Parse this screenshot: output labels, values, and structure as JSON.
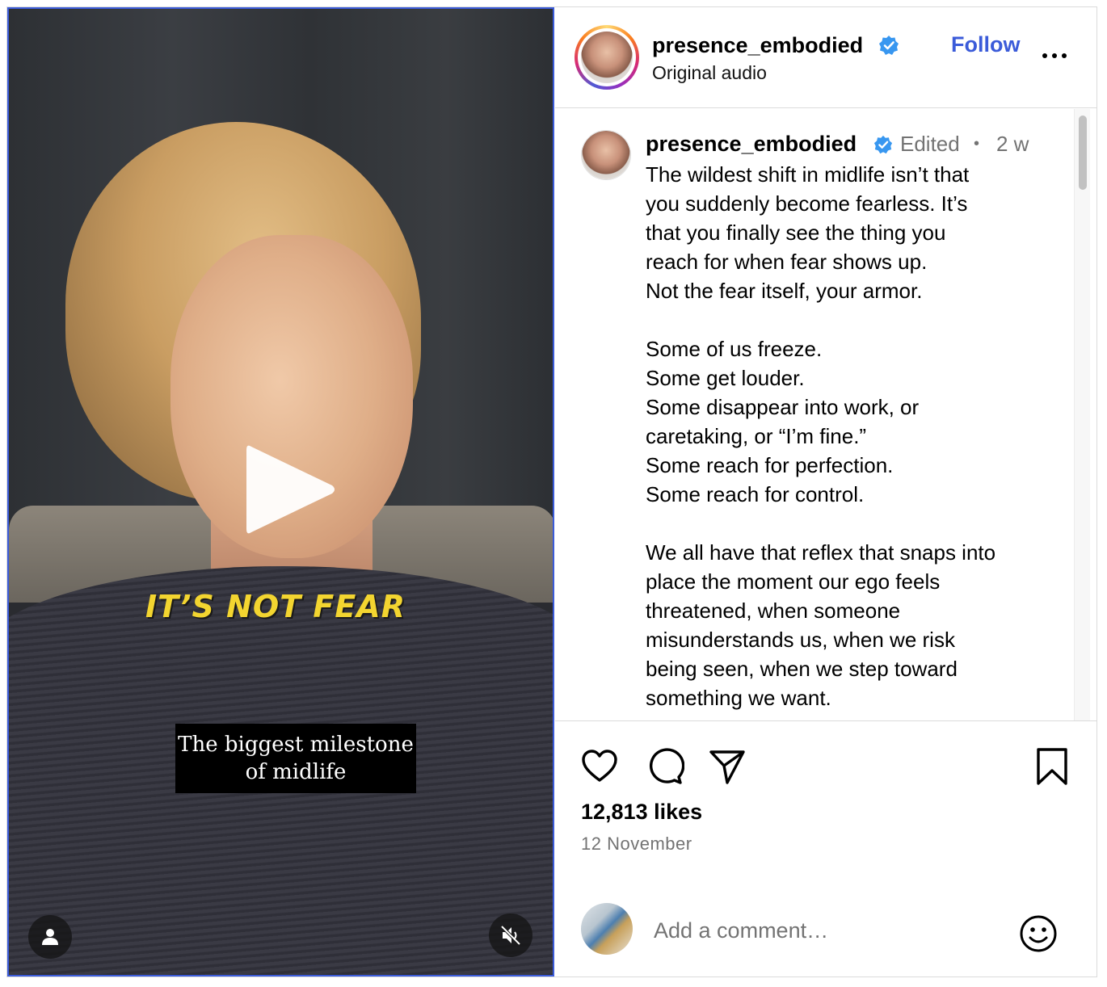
{
  "video": {
    "overlay_text": "IT’S NOT FEAR",
    "caption_line1": "The biggest milestone",
    "caption_line2": "of midlife",
    "buttons": {
      "play": "play-icon",
      "profile": "user-icon",
      "mute": "muted-speaker-icon"
    }
  },
  "header": {
    "username": "presence_embodied",
    "verified": true,
    "subtitle": "Original audio",
    "follow_label": "Follow",
    "more_icon": "more-horizontal-icon"
  },
  "post": {
    "username": "presence_embodied",
    "edited": "Edited",
    "separator": "•",
    "age": "2 w",
    "caption": "The wildest shift in midlife isn’t that\nyou suddenly become fearless. It’s\nthat you finally see the thing you\nreach for when fear shows up.\nNot the fear itself, your armor.\n\nSome of us freeze.\nSome get louder.\nSome disappear into work, or\ncaretaking, or “I’m fine.”\nSome reach for perfection.\nSome reach for control.\n\nWe all have that reflex that snaps into\nplace the moment our ego feels\nthreatened, when someone\nmisunderstands us, when we risk\nbeing seen, when we step toward\nsomething we want."
  },
  "actions": {
    "like_icon": "heart-icon",
    "comment_icon": "comment-icon",
    "share_icon": "share-icon",
    "save_icon": "bookmark-icon",
    "likes": "12,813 likes",
    "date": "12 November"
  },
  "comment": {
    "placeholder": "Add a comment…",
    "emoji_icon": "emoji-icon"
  },
  "colors": {
    "accent": "#3b5bd9",
    "verified": "#3897f0",
    "muted_text": "#737373",
    "overlay_yellow": "#f3d530"
  }
}
